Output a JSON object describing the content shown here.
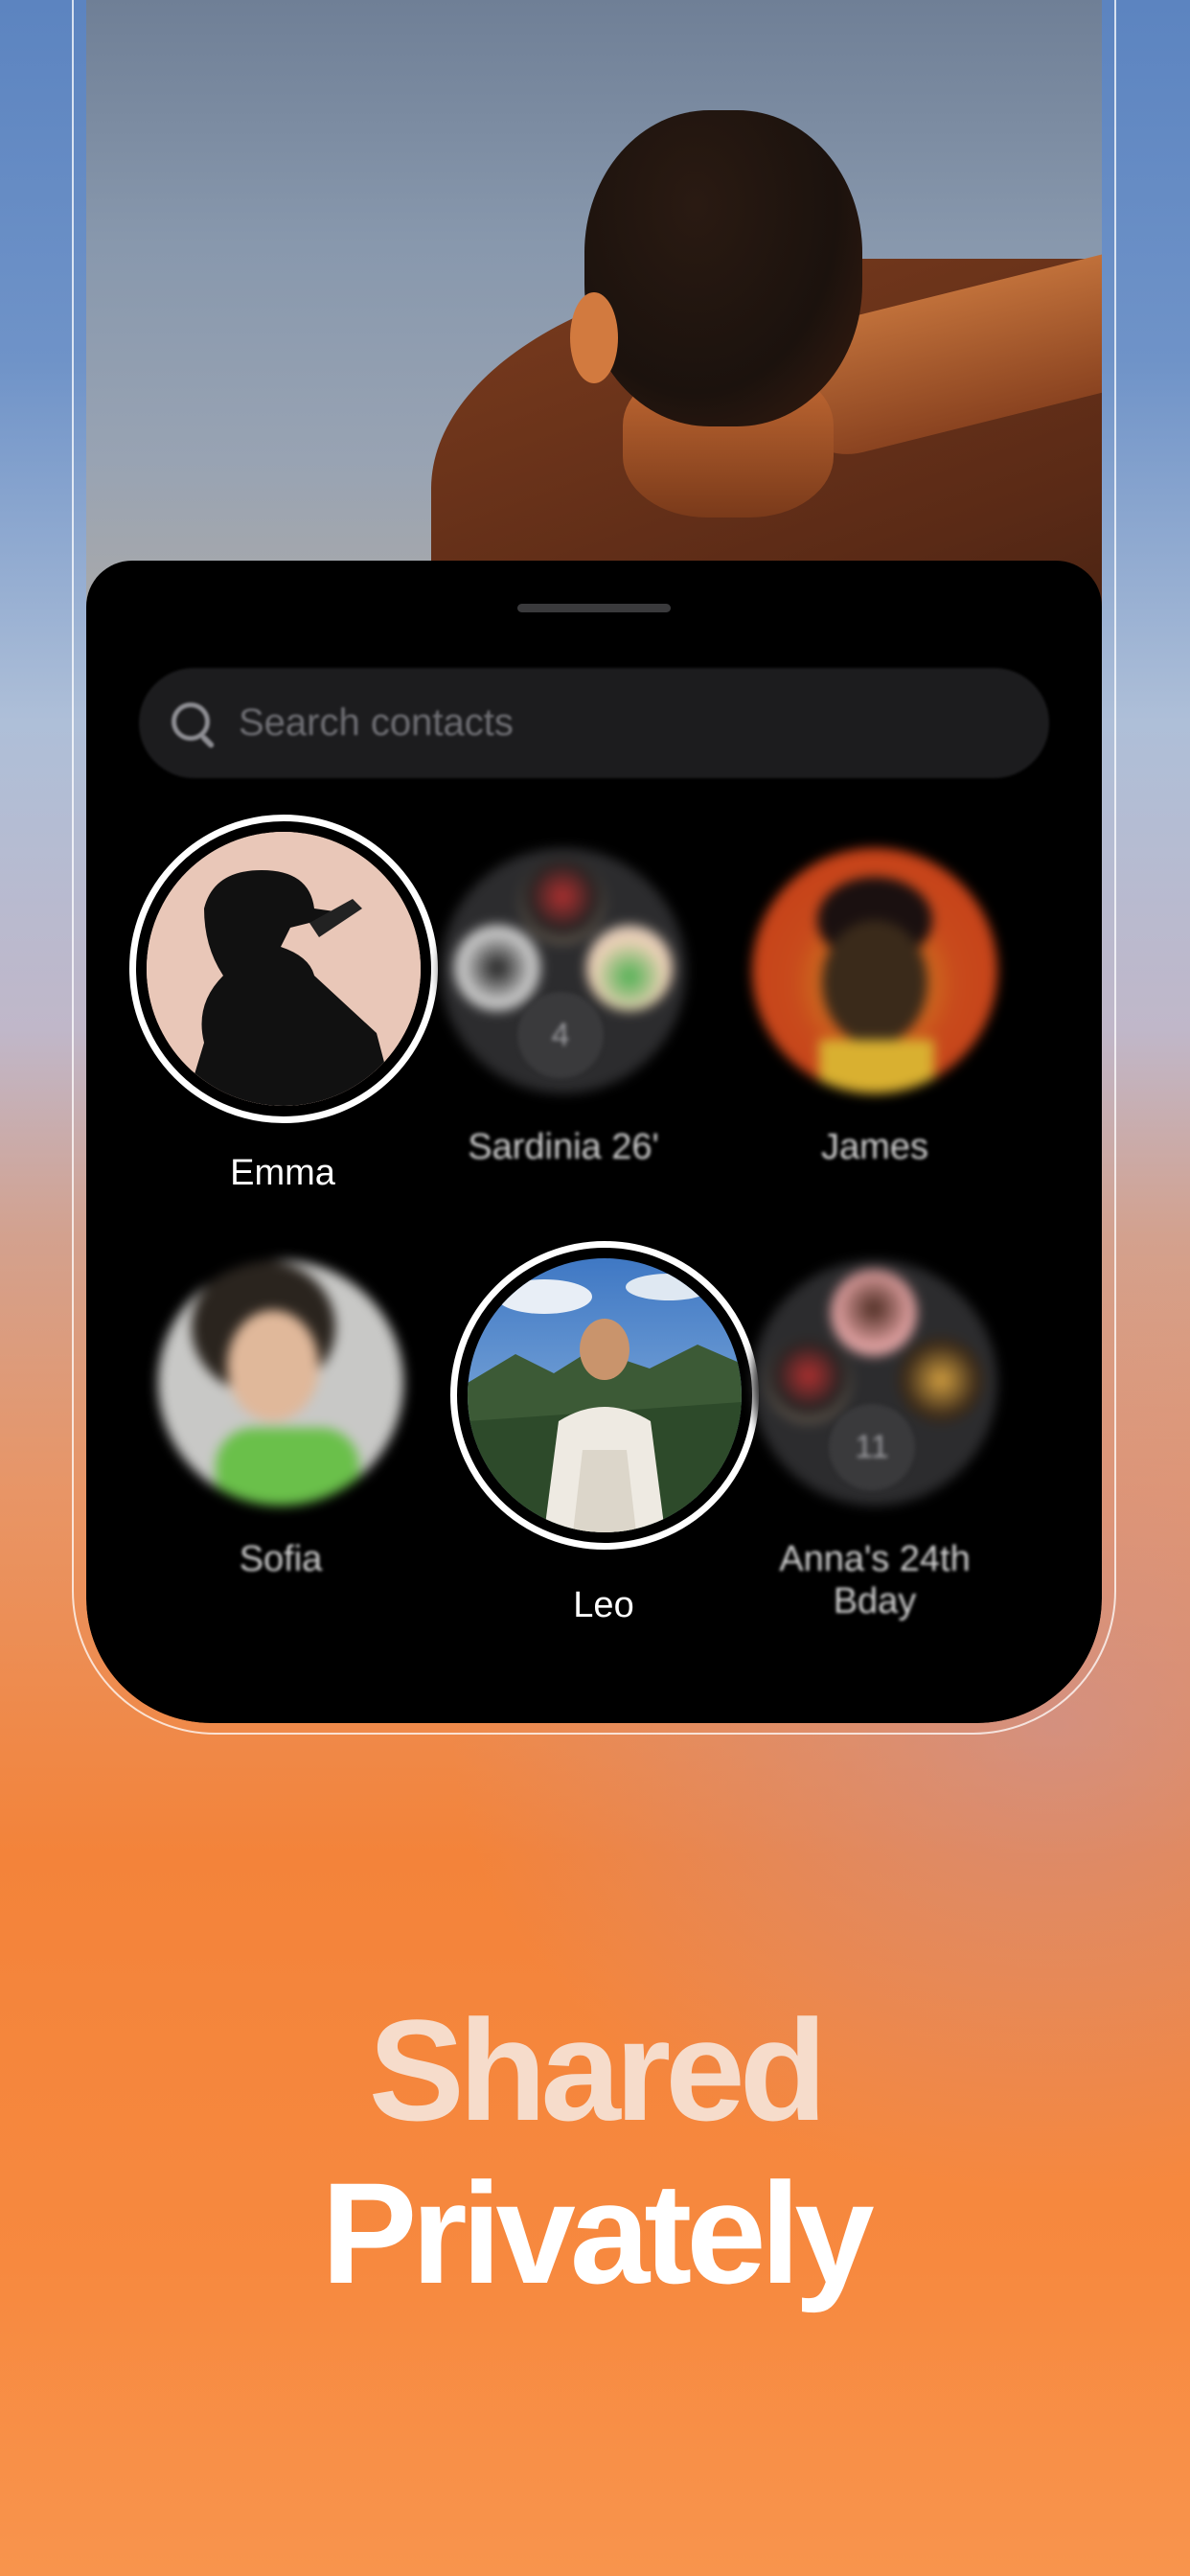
{
  "search": {
    "placeholder": "Search contacts"
  },
  "contacts": [
    {
      "name": "Emma",
      "selected": true
    },
    {
      "name": "Sardinia 26'",
      "count": "4",
      "selected": false
    },
    {
      "name": "James",
      "selected": false
    },
    {
      "name": "Sofia",
      "selected": false
    },
    {
      "name": "Leo",
      "selected": true
    },
    {
      "name": "Anna's 24th\nBday",
      "count": "11",
      "selected": false
    }
  ],
  "headline": {
    "line1": "Shared",
    "line2": "Privately"
  },
  "colors": {
    "sheet": "#000000",
    "accent_orange": "#f7893f",
    "accent_blue": "#5c84c0",
    "ring": "#ffffff"
  },
  "icons": {
    "search": "search-icon"
  }
}
